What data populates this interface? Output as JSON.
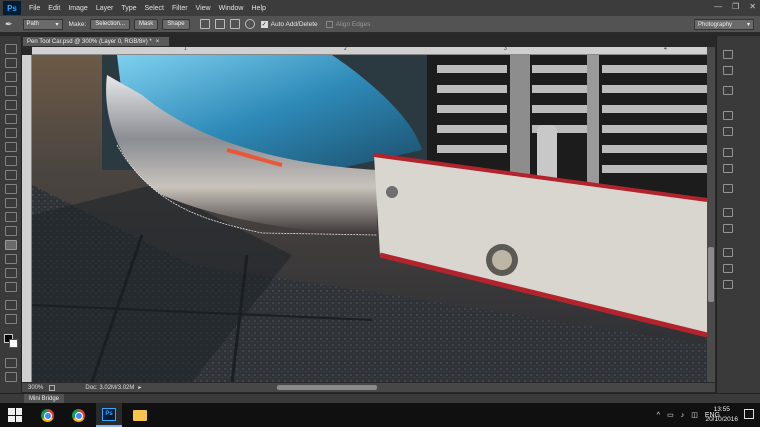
{
  "app": {
    "logo": "Ps"
  },
  "menubar": {
    "items": [
      "File",
      "Edit",
      "Image",
      "Layer",
      "Type",
      "Select",
      "Filter",
      "View",
      "Window",
      "Help"
    ]
  },
  "options": {
    "mode": "Path",
    "make_label": "Make:",
    "selection_btn": "Selection...",
    "mask_btn": "Mask",
    "shape_btn": "Shape",
    "auto_add_delete": "Auto Add/Delete",
    "align_edges": "Align Edges"
  },
  "workspace": "Photography",
  "document": {
    "tab_title": "Pen Tool Car.psd @ 300% (Layer 0, RGB/8#) *"
  },
  "ruler": {
    "ticks": [
      "1",
      "2",
      "3",
      "4"
    ]
  },
  "status": {
    "zoom": "300%",
    "doc_info": "Doc: 3.02M/3.02M"
  },
  "mini_bridge": {
    "label": "Mini Bridge"
  },
  "taskbar": {
    "lang": "ENG",
    "time": "13:55",
    "date": "20/10/2016"
  },
  "colors": {
    "accent": "#31a8ff",
    "taskbar": "#101010"
  }
}
